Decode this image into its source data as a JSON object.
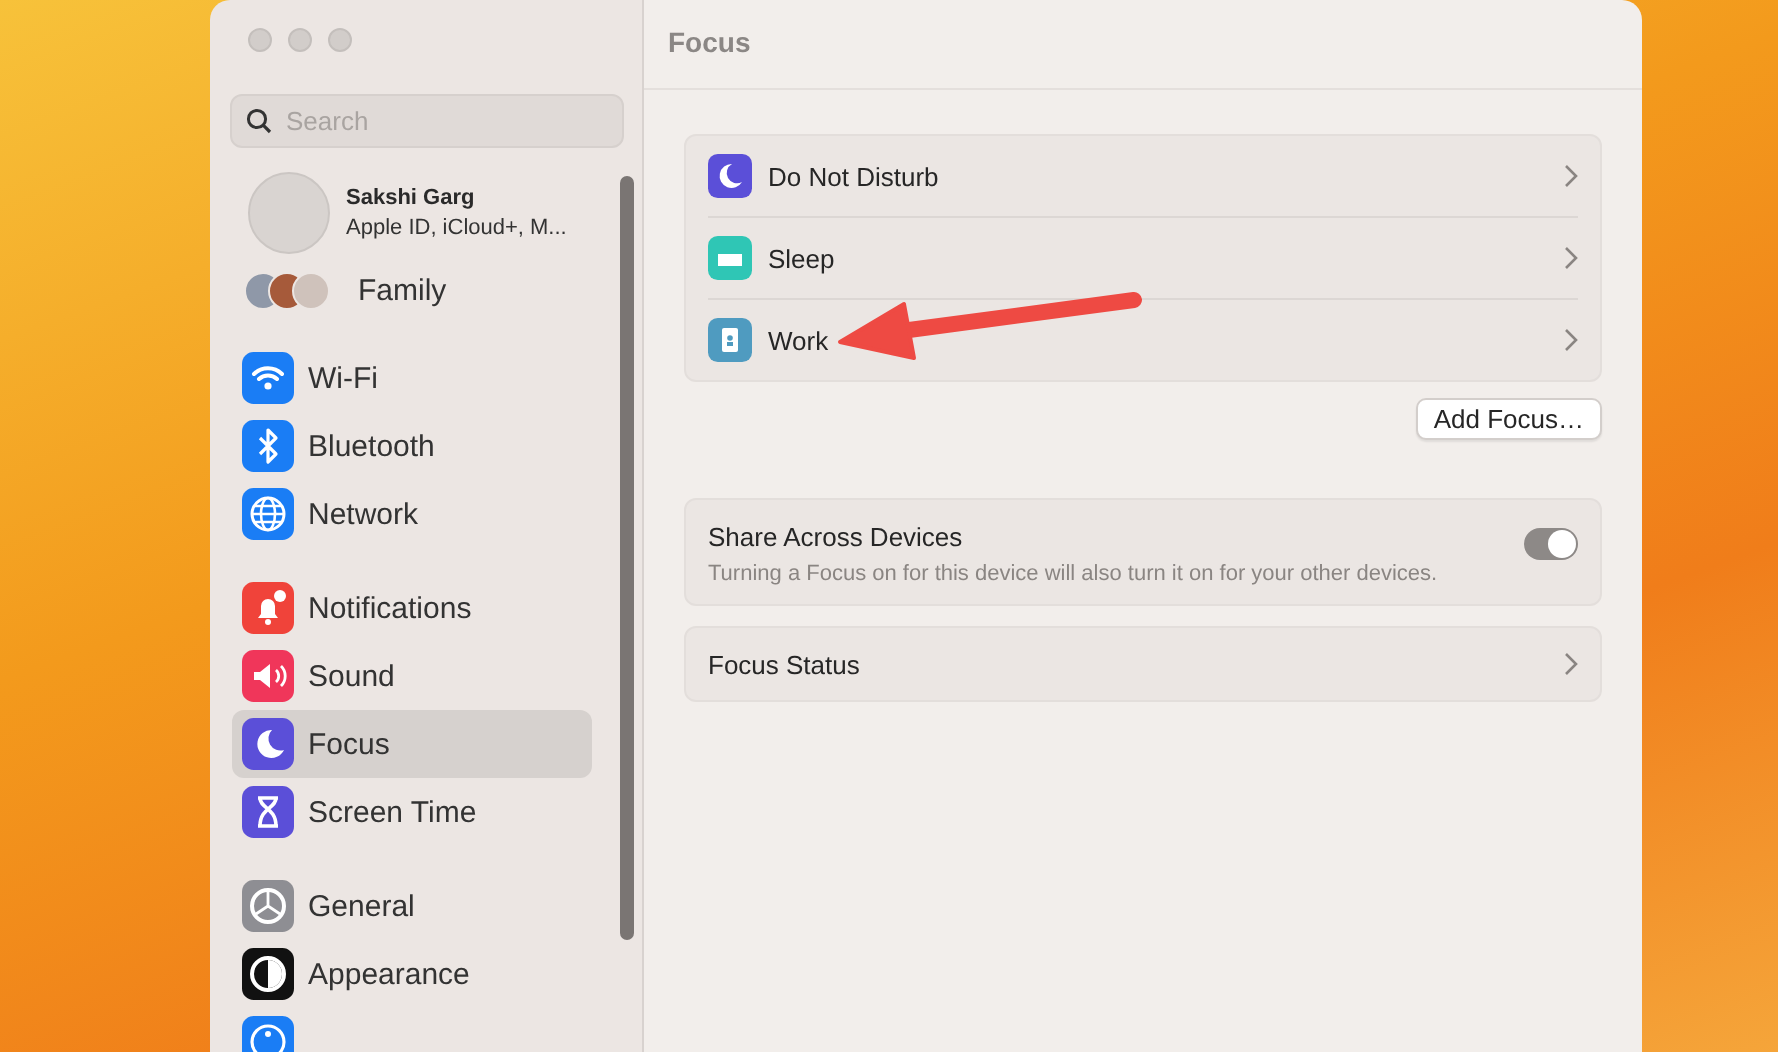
{
  "sidebar": {
    "search": {
      "placeholder": "Search"
    },
    "account": {
      "name": "Sakshi Garg",
      "detail": "Apple ID, iCloud+, M..."
    },
    "family": {
      "label": "Family"
    },
    "groups": [
      {
        "items": [
          {
            "kind": "row",
            "label": "Wi-Fi",
            "selected": false
          },
          {
            "kind": "row",
            "label": "Bluetooth",
            "selected": false
          },
          {
            "kind": "row",
            "label": "Network",
            "selected": false
          }
        ]
      },
      {
        "items": [
          {
            "kind": "row",
            "label": "Notifications",
            "selected": false
          },
          {
            "kind": "row",
            "label": "Sound",
            "selected": false
          },
          {
            "kind": "row",
            "label": "Focus",
            "selected": true
          },
          {
            "kind": "row",
            "label": "Screen Time",
            "selected": false
          }
        ]
      },
      {
        "items": [
          {
            "kind": "row",
            "label": "General",
            "selected": false
          },
          {
            "kind": "row",
            "label": "Appearance",
            "selected": false
          },
          {
            "kind": "clipped",
            "selected": false
          }
        ]
      }
    ]
  },
  "pane": {
    "title": "Focus",
    "focus_modes": [
      {
        "label": "Do Not Disturb"
      },
      {
        "label": "Sleep"
      },
      {
        "label": "Work"
      }
    ],
    "add_button": "Add Focus…",
    "share": {
      "title": "Share Across Devices",
      "description": "Turning a Focus on for this device will also turn it on for your other devices.",
      "on": true
    },
    "status": {
      "label": "Focus Status"
    }
  }
}
